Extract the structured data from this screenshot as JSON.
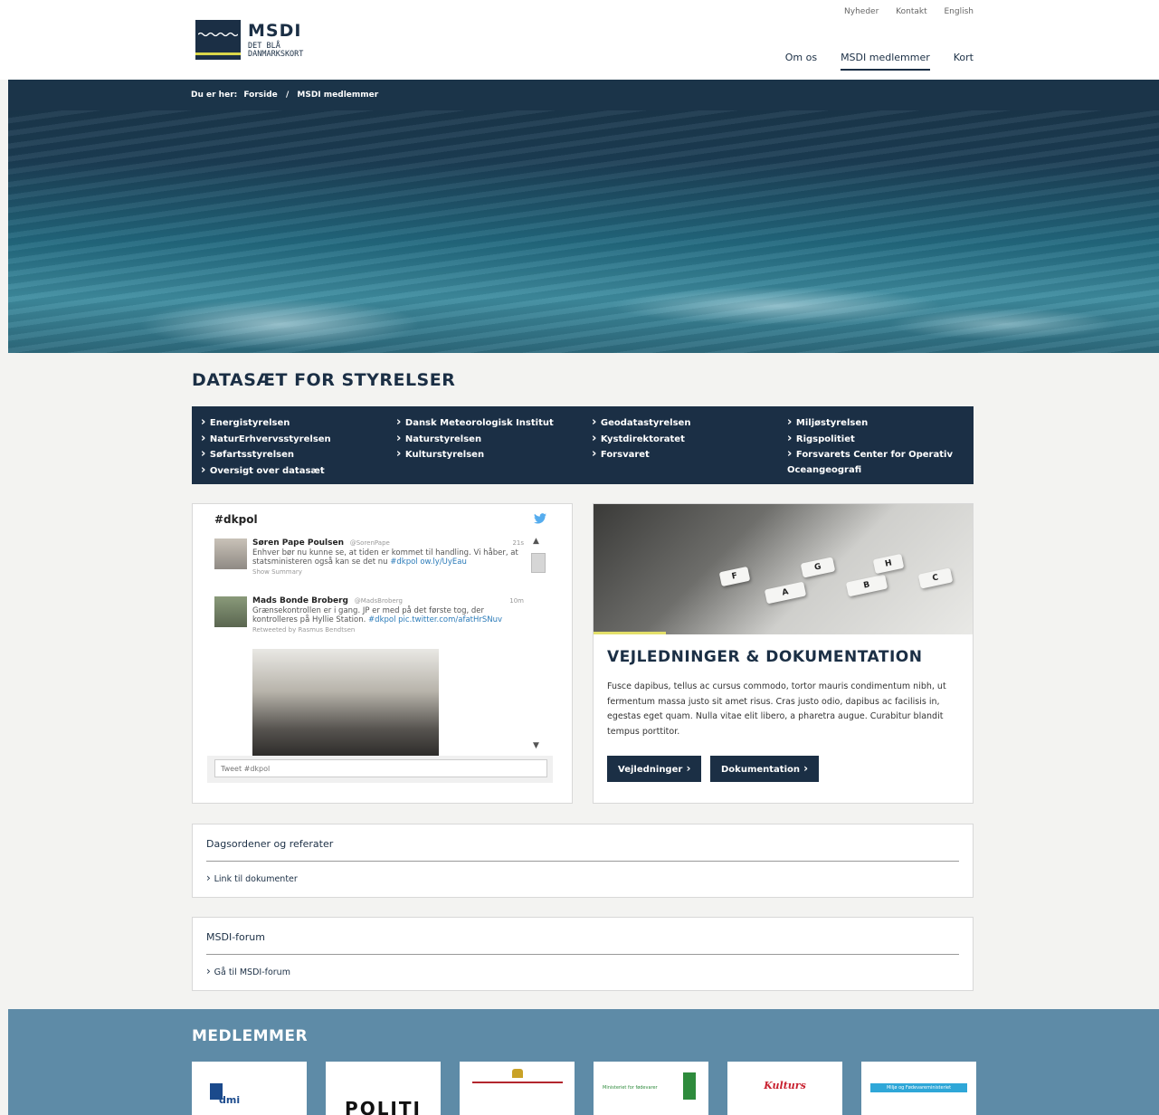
{
  "header": {
    "logo": {
      "title": "MSDI",
      "subtitle_line1": "DET BLÅ",
      "subtitle_line2": "DANMARKSKORT"
    },
    "util_nav": [
      "Nyheder",
      "Kontakt",
      "English"
    ],
    "main_nav": [
      {
        "label": "Om os",
        "active": false
      },
      {
        "label": "MSDI medlemmer",
        "active": true
      },
      {
        "label": "Kort",
        "active": false
      }
    ]
  },
  "breadcrumb": {
    "prefix": "Du er her:",
    "home": "Forside",
    "separator": "/",
    "current": "MSDI medlemmer"
  },
  "datasets": {
    "title": "DATASÆT FOR STYRELSER",
    "columns": [
      [
        "Energistyrelsen",
        "NaturErhvervsstyrelsen",
        "Søfartsstyrelsen",
        "Oversigt over datasæt"
      ],
      [
        "Dansk Meteorologisk Institut",
        "Naturstyrelsen",
        "Kulturstyrelsen"
      ],
      [
        "Geodatastyrelsen",
        "Kystdirektoratet",
        "Forsvaret"
      ],
      [
        "Miljøstyrelsen",
        "Rigspolitiet",
        "Forsvarets Center for Operativ Oceangeografi"
      ]
    ]
  },
  "twitter": {
    "hashtag": "#dkpol",
    "tweets": [
      {
        "name": "Søren Pape Poulsen",
        "handle": "@SorenPape",
        "time": "21s",
        "text": "Enhver bør nu kunne se, at tiden er kommet til handling. Vi håber, at statsministeren også kan se det nu",
        "links": "#dkpol ow.ly/UyEau",
        "meta": "Show Summary"
      },
      {
        "name": "Mads Bonde Broberg",
        "handle": "@MadsBroberg",
        "time": "10m",
        "text": "Grænsekontrollen er i gang. JP er med på det første tog, der kontrolleres på Hyllie Station.",
        "links": "#dkpol pic.twitter.com/afatHrSNuv",
        "meta": "Retweeted by Rasmus Bendtsen"
      }
    ],
    "input_placeholder": "Tweet #dkpol"
  },
  "guides": {
    "image_keys": [
      "F",
      "A",
      "G",
      "B",
      "C",
      "H"
    ],
    "title": "VEJLEDNINGER & DOKUMENTATION",
    "text": "Fusce dapibus, tellus ac cursus commodo, tortor mauris condimentum nibh, ut fermentum massa justo sit amet risus. Cras justo odio, dapibus ac facilisis in, egestas eget quam. Nulla vitae elit libero, a pharetra augue. Curabitur blandit tempus porttitor.",
    "buttons": [
      "Vejledninger",
      "Dokumentation"
    ]
  },
  "panels": [
    {
      "title": "Dagsordener og referater",
      "link": "Link til dokumenter"
    },
    {
      "title": "MSDI-forum",
      "link": "Gå til MSDI-forum"
    }
  ],
  "members": {
    "title": "MEDLEMMER",
    "logos": [
      {
        "label": "dmi",
        "color": "#1b4a8c"
      },
      {
        "label": "POLITI",
        "color": "#111111"
      },
      {
        "label": "",
        "color": "#b3262d"
      },
      {
        "label": "Ministeriet for fødevarer",
        "color": "#2e8b3c"
      },
      {
        "label": "Kulturs",
        "color": "#c8202f"
      },
      {
        "label": "Miljø og Fødevareministeriet",
        "color": "#2fa7d8"
      }
    ]
  }
}
